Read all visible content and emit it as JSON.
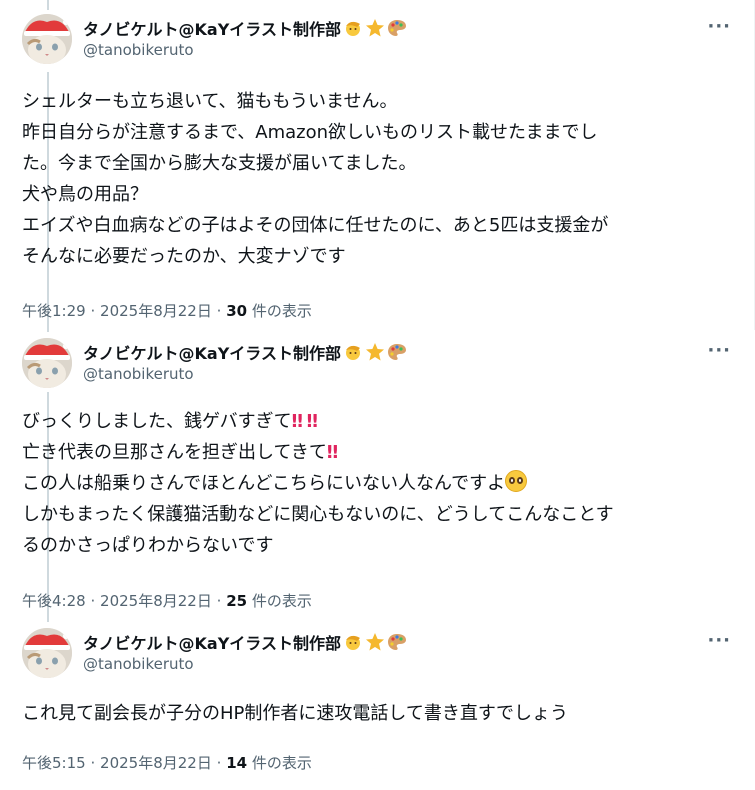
{
  "tweets": [
    {
      "display_name": "タノビケルト@KaYイラスト制作部",
      "handle": "@tanobikeruto",
      "body_lines": [
        "シェルターも立ち退いて、猫ももういません。",
        "昨日自分らが注意するまで、Amazon欲しいものリスト載せたままでし",
        "た。今まで全国から膨大な支援が届いてました。",
        "犬や鳥の用品？",
        "エイズや白血病などの子はよその団体に任せたのに、あと5匹は支援金が",
        "そんなに必要だったのか、大変ナゾです"
      ],
      "time": "午後1:29",
      "date": "2025年8月22日",
      "views_count": "30",
      "views_label": "件の表示"
    },
    {
      "display_name": "タノビケルト@KaYイラスト制作部",
      "handle": "@tanobikeruto",
      "body_lines": [
        "びっくりしました、銭ゲバすぎて",
        "亡き代表の旦那さんを担ぎ出してきて",
        "この人は船乗りさんでほとんどこちらにいない人なんですよ",
        "しかもまったく保護猫活動などに関心もないのに、どうしてこんなことす",
        "るのかさっぱりわからないです"
      ],
      "time": "午後4:28",
      "date": "2025年8月22日",
      "views_count": "25",
      "views_label": "件の表示"
    },
    {
      "display_name": "タノビケルト@KaYイラスト制作部",
      "handle": "@tanobikeruto",
      "body_lines": [
        "これ見て副会長が子分のHP制作者に速攻電話して書き直すでしょう"
      ],
      "time": "午後5:15",
      "date": "2025年8月22日",
      "views_count": "14",
      "views_label": "件の表示"
    }
  ],
  "more_glyph": "···",
  "meta_separator": "·",
  "emoji": {
    "double_exclamation": "‼",
    "pleading_face": "pleading-face-icon"
  },
  "colors": {
    "text_primary": "#0f1419",
    "text_secondary": "#536471",
    "thread_line": "#cfd9de",
    "exclamation": "#e0245e"
  }
}
